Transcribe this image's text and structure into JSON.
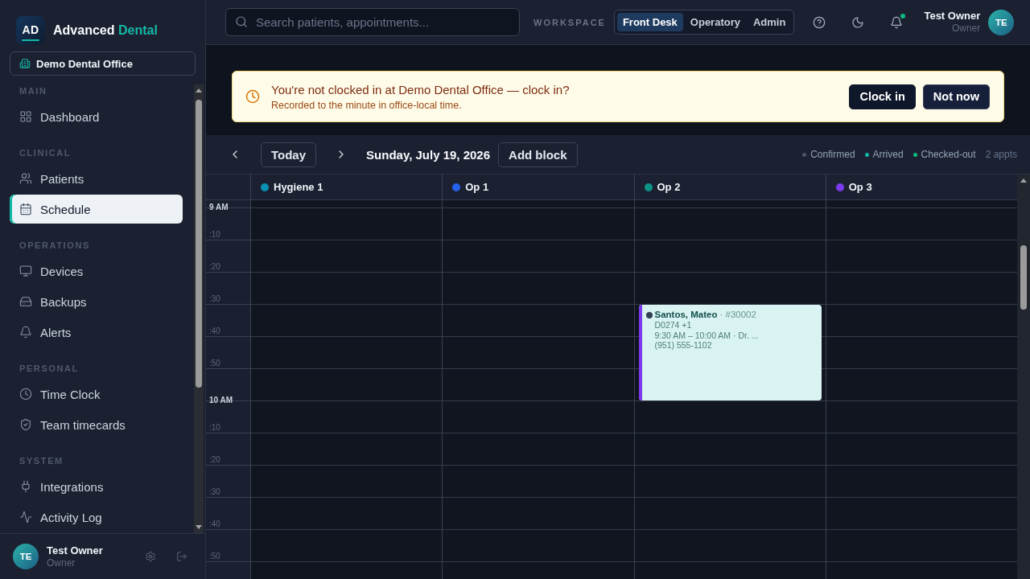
{
  "sidebar": {
    "logo": {
      "initials": "AD",
      "name": "Advanced",
      "name_accent": "Dental"
    },
    "office": "Demo Dental Office",
    "sections": [
      {
        "title": "MAIN",
        "items": [
          {
            "label": "Dashboard",
            "selected": false
          }
        ]
      },
      {
        "title": "CLINICAL",
        "items": [
          {
            "label": "Patients",
            "selected": false
          },
          {
            "label": "Schedule",
            "selected": true
          }
        ]
      },
      {
        "title": "OPERATIONS",
        "items": [
          {
            "label": "Devices",
            "selected": false
          },
          {
            "label": "Backups",
            "selected": false
          },
          {
            "label": "Alerts",
            "selected": false
          }
        ]
      },
      {
        "title": "PERSONAL",
        "items": [
          {
            "label": "Time Clock",
            "selected": false
          },
          {
            "label": "Team timecards",
            "selected": false
          }
        ]
      },
      {
        "title": "SYSTEM",
        "items": [
          {
            "label": "Integrations",
            "selected": false
          },
          {
            "label": "Activity Log",
            "selected": false
          }
        ]
      }
    ],
    "user": {
      "initials": "TE",
      "name": "Test Owner",
      "role": "Owner"
    }
  },
  "topbar": {
    "search": {
      "placeholder": "Search patients, appointments..."
    },
    "workspace_label": "WORKSPACE",
    "workspaces": [
      {
        "label": "Front Desk",
        "selected": true
      },
      {
        "label": "Operatory",
        "selected": false
      },
      {
        "label": "Admin",
        "selected": false
      }
    ],
    "notifications": {
      "unread": true
    },
    "user": {
      "initials": "TE",
      "name": "Test Owner",
      "role": "Owner"
    }
  },
  "banner": {
    "title": "You're not clocked in at Demo Dental Office — clock in?",
    "subtitle": "Recorded to the minute in office-local time.",
    "buttons": [
      {
        "label": "Clock in",
        "kind": "primary"
      },
      {
        "label": "Not now",
        "kind": "secondary"
      }
    ]
  },
  "calendar": {
    "today_button": "Today",
    "date": "Sunday, July 19, 2026",
    "add_block_button": "Add block",
    "legend": [
      {
        "label": "Confirmed",
        "color": "#4b5563"
      },
      {
        "label": "Arrived",
        "color": "#14b8a6"
      },
      {
        "label": "Checked-out",
        "color": "#10b981"
      }
    ],
    "count": "2 appts",
    "columns": [
      {
        "name": "Hygiene 1",
        "color": "#0891b2"
      },
      {
        "name": "Op 1",
        "color": "#2563eb"
      },
      {
        "name": "Op 2",
        "color": "#0d9488",
        "appointments": [
          {
            "patient": "Santos, Mateo",
            "chart": "· #30002",
            "procedures": "D0274 +1",
            "time": "9:30 AM – 10:00 AM · Dr. ...",
            "phone": "(951) 555-1102",
            "status_dot": {
              "color": "#334155"
            },
            "color": "#7c3aed"
          }
        ]
      },
      {
        "name": "Op 3",
        "color": "#7c3aed"
      }
    ],
    "time_slots": [
      {
        "label": "9 AM",
        "kind": "hour"
      },
      {
        "label": ":10",
        "kind": "minute"
      },
      {
        "label": ":20",
        "kind": "minute"
      },
      {
        "label": ":30",
        "kind": "minute"
      },
      {
        "label": ":40",
        "kind": "minute"
      },
      {
        "label": ":50",
        "kind": "minute"
      },
      {
        "label": "10 AM",
        "kind": "hour"
      },
      {
        "label": ":10",
        "kind": "minute"
      },
      {
        "label": ":20",
        "kind": "minute"
      },
      {
        "label": ":30",
        "kind": "minute"
      },
      {
        "label": ":40",
        "kind": "minute"
      },
      {
        "label": ":50",
        "kind": "minute"
      }
    ]
  }
}
